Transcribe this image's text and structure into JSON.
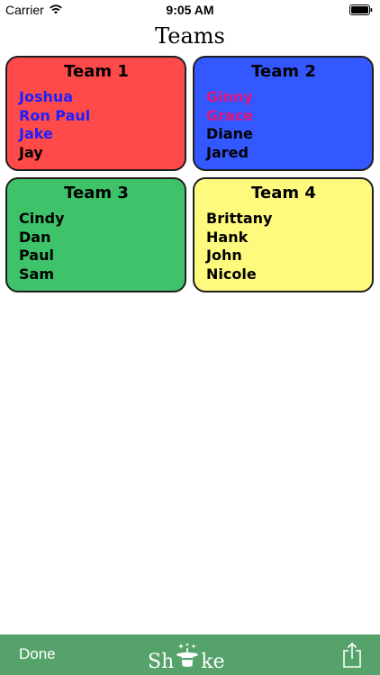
{
  "status_bar": {
    "carrier": "Carrier",
    "time": "9:05 AM",
    "wifi_icon": "wifi-icon",
    "battery_icon": "battery-icon"
  },
  "page": {
    "title": "Teams"
  },
  "teams": [
    {
      "name": "Team 1",
      "color": "#fe4a49",
      "members": [
        {
          "name": "Joshua",
          "color": "#1e1eff"
        },
        {
          "name": "Ron Paul",
          "color": "#1e1eff"
        },
        {
          "name": "Jake",
          "color": "#1e1eff"
        },
        {
          "name": "Jay",
          "color": "#000000"
        }
      ]
    },
    {
      "name": "Team 2",
      "color": "#3358ff",
      "members": [
        {
          "name": "Ginny",
          "color": "#e0167a"
        },
        {
          "name": "Grace",
          "color": "#e0167a"
        },
        {
          "name": "Diane",
          "color": "#000000"
        },
        {
          "name": "Jared",
          "color": "#000000"
        }
      ]
    },
    {
      "name": "Team 3",
      "color": "#3ec36b",
      "members": [
        {
          "name": "Cindy",
          "color": "#000000"
        },
        {
          "name": "Dan",
          "color": "#000000"
        },
        {
          "name": "Paul",
          "color": "#000000"
        },
        {
          "name": "Sam",
          "color": "#000000"
        }
      ]
    },
    {
      "name": "Team 4",
      "color": "#fefa7e",
      "members": [
        {
          "name": "Brittany",
          "color": "#000000"
        },
        {
          "name": "Hank",
          "color": "#000000"
        },
        {
          "name": "John",
          "color": "#000000"
        },
        {
          "name": "Nicole",
          "color": "#000000"
        }
      ]
    }
  ],
  "toolbar": {
    "done_label": "Done",
    "logo_left": "Sh",
    "logo_right": "ke",
    "logo_icon": "magic-hat-icon",
    "share_icon": "share-icon",
    "background": "#55a36b"
  }
}
